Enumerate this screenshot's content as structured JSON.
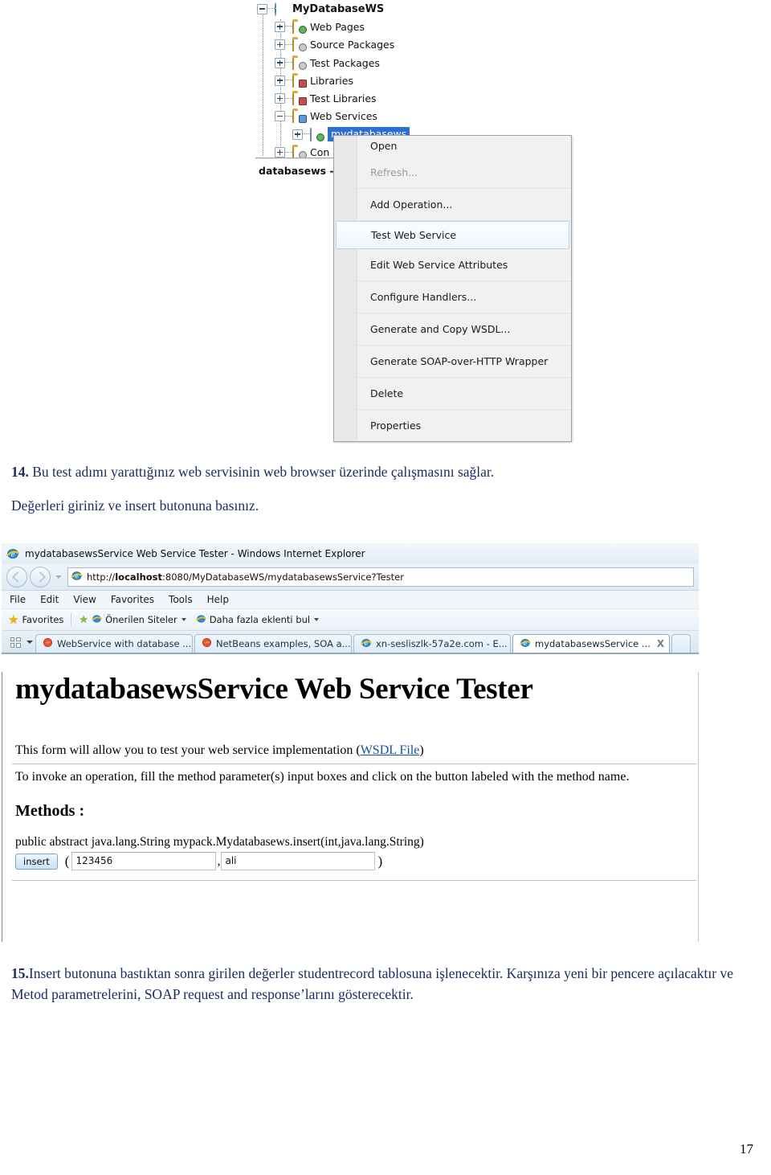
{
  "netbeans": {
    "tree": [
      {
        "label": "MyDatabaseWS",
        "icon": "globe-icon",
        "expander": "minus",
        "depth": 0,
        "root": true
      },
      {
        "label": "Web Pages",
        "icon": "folder-web-icon",
        "expander": "plus",
        "depth": 1
      },
      {
        "label": "Source Packages",
        "icon": "folder-source-icon",
        "expander": "plus",
        "depth": 1
      },
      {
        "label": "Test Packages",
        "icon": "folder-test-icon",
        "expander": "plus",
        "depth": 1
      },
      {
        "label": "Libraries",
        "icon": "folder-libraries-icon",
        "expander": "plus",
        "depth": 1
      },
      {
        "label": "Test Libraries",
        "icon": "folder-test-libraries-icon",
        "expander": "plus",
        "depth": 1
      },
      {
        "label": "Web Services",
        "icon": "folder-webservices-icon",
        "expander": "minus",
        "depth": 1
      },
      {
        "label": "mydatabasews",
        "icon": "webservice-icon",
        "expander": "plus",
        "depth": 2,
        "selected": true
      },
      {
        "label": "Con",
        "icon": "folder-configuration-icon",
        "expander": "plus",
        "depth": 1
      }
    ],
    "status_label": "databasews -",
    "context_menu": [
      {
        "label": "Open",
        "state": "normal"
      },
      {
        "label": "Refresh...",
        "state": "disabled"
      },
      {
        "label": "Add Operation...",
        "state": "normal"
      },
      {
        "label": "Test Web Service",
        "state": "highlighted"
      },
      {
        "label": "Edit Web Service Attributes",
        "state": "normal"
      },
      {
        "label": "Configure Handlers...",
        "state": "normal"
      },
      {
        "label": "Generate and Copy WSDL...",
        "state": "normal"
      },
      {
        "label": "Generate SOAP-over-HTTP Wrapper",
        "state": "normal"
      },
      {
        "label": "Delete",
        "state": "normal"
      },
      {
        "label": "Properties",
        "state": "normal"
      }
    ]
  },
  "doc": {
    "step14_num": "14.",
    "step14_line1": "Bu test adımı yarattığınız web servisinin web browser üzerinde çalışmasını sağlar.",
    "step14_line2": "Değerleri giriniz ve insert butonuna basınız.",
    "step15_num": "15.",
    "step15_text": "Insert butonuna bastıktan sonra  girilen değerler studentrecord tablosuna işlenecektir. Karşınıza yeni bir pencere açılacaktır ve Metod parametrelerini, SOAP request and response’larını gösterecektir.",
    "page_number": "17"
  },
  "browser": {
    "window_title": "mydatabasewsService Web Service Tester - Windows Internet Explorer",
    "url_prefix": "http://",
    "url_host": "localhost",
    "url_rest": ":8080/MyDatabaseWS/mydatabasewsService?Tester",
    "menubar": [
      "File",
      "Edit",
      "View",
      "Favorites",
      "Tools",
      "Help"
    ],
    "favbar": {
      "favorites_label": "Favorites",
      "suggested_sites": "Önerilen Siteler",
      "get_more_addons": "Daha fazla eklenti bul"
    },
    "tabs": [
      {
        "label": "WebService with database ...",
        "icon": "firefox-icon",
        "active": false
      },
      {
        "label": "NetBeans examples, SOA a...",
        "icon": "firefox-icon",
        "active": false
      },
      {
        "label": "xn-sesliszlk-57a2e.com - E...",
        "icon": "ie-icon",
        "active": false
      },
      {
        "label": "mydatabasewsService ...",
        "icon": "ie-icon",
        "active": true,
        "close": "X"
      }
    ],
    "page": {
      "h1": "mydatabasewsService Web Service Tester",
      "intro_before": "This form will allow you to test your web service implementation (",
      "intro_link": "WSDL File",
      "intro_after": ")",
      "invoke_text": "To invoke an operation, fill the method parameter(s) input boxes and click on the button labeled with the method name.",
      "methods_heading": "Methods :",
      "method_signature": "public abstract java.lang.String mypack.Mydatabasews.insert(int,java.lang.String)",
      "insert_button": "insert",
      "open_paren": "(",
      "close_paren": ")",
      "comma": ",",
      "param1_value": "123456",
      "param2_value": "ali"
    }
  }
}
